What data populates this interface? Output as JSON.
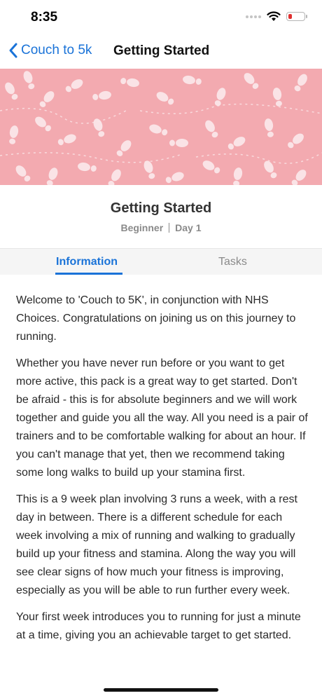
{
  "status": {
    "time": "8:35"
  },
  "nav": {
    "back_label": "Couch to 5k",
    "title": "Getting Started"
  },
  "page": {
    "title": "Getting Started",
    "level": "Beginner",
    "day": "Day 1"
  },
  "tabs": [
    {
      "label": "Information",
      "active": true
    },
    {
      "label": "Tasks",
      "active": false
    }
  ],
  "content": {
    "paragraphs": [
      "Welcome to 'Couch to 5K', in conjunction with NHS Choices. Congratulations on joining us on this journey to running.",
      "Whether you have never run before or you want to get more active, this pack is a great way to get started. Don't be afraid - this is for absolute beginners and we will work together and guide you all the way. All you need is a pair of trainers and to be comfortable walking for about an hour. If you can't manage that yet, then we recommend taking some long walks to build up your stamina first.",
      "This is a 9 week plan involving 3 runs a week, with a rest day in between. There is a different schedule for each week involving a mix of running and walking to gradually build up your fitness and stamina. Along the way you will see clear signs of how much your fitness is improving, especially as you will be able to run further every week.",
      "Your first week introduces you to running for just a minute at a time, giving you an achievable target to get started."
    ]
  },
  "colors": {
    "accent": "#1a73d8",
    "hero_bg": "#f3aab0",
    "battery_low": "#e03030"
  }
}
